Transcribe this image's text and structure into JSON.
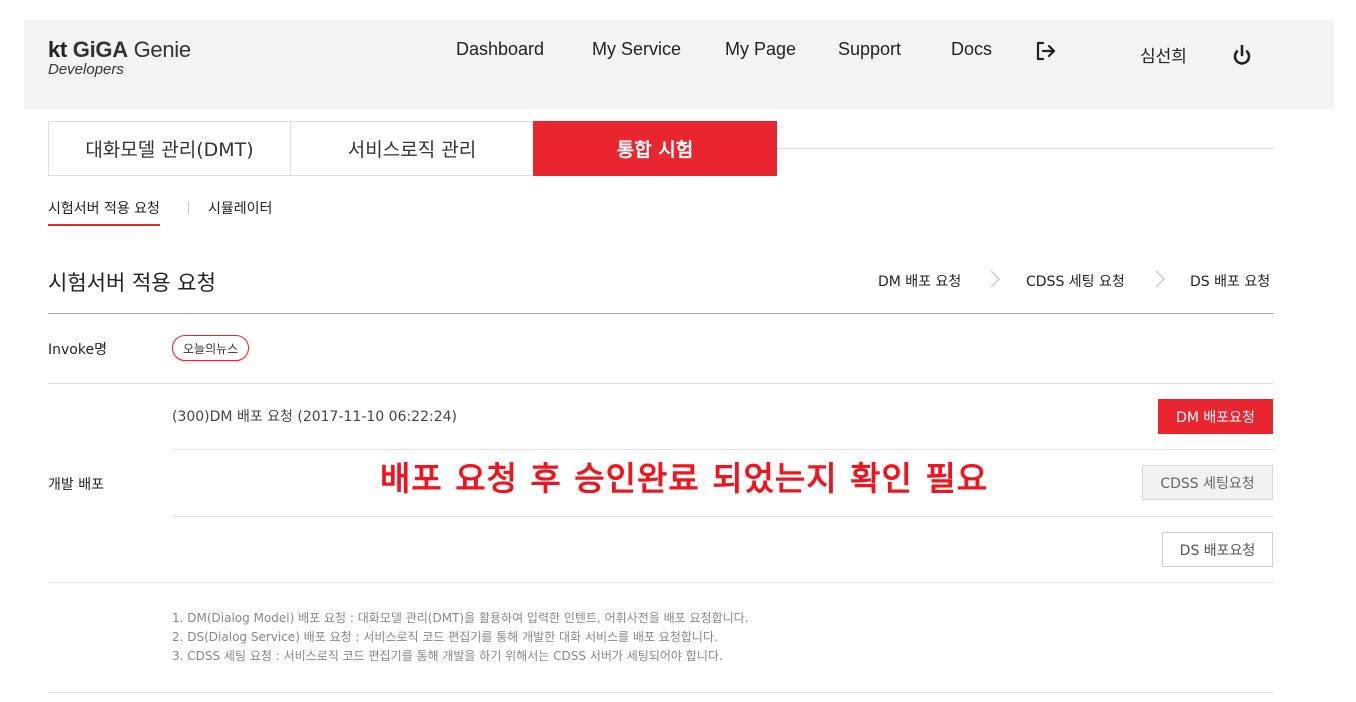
{
  "header": {
    "logo": {
      "kt": "kt",
      "giga": "GiGA",
      "genie": "Genie",
      "sub": "Developers"
    },
    "nav": [
      "Dashboard",
      "My Service",
      "My Page",
      "Support",
      "Docs"
    ],
    "user_name": "심선희",
    "icons": {
      "logout": "logout-icon",
      "power": "power-icon"
    }
  },
  "tabs": [
    {
      "label": "대화모델 관리(DMT)",
      "active": false
    },
    {
      "label": "서비스로직 관리",
      "active": false
    },
    {
      "label": "통합 시험",
      "active": true
    }
  ],
  "subnav": {
    "items": [
      "시험서버 적용 요청",
      "시뮬레이터"
    ],
    "active_index": 0
  },
  "section": {
    "title": "시험서버 적용 요청",
    "steps": [
      "DM 배포 요청",
      "CDSS 세팅 요청",
      "DS 배포 요청"
    ]
  },
  "invoke": {
    "label": "Invoke명",
    "value": "오늘의뉴스"
  },
  "deploy": {
    "label": "개발 배포",
    "status": "(300)DM 배포 요청 (2017-11-10 06:22:24)",
    "buttons": {
      "dm": "DM 배포요청",
      "cdss": "CDSS 세팅요청",
      "ds": "DS 배포요청"
    }
  },
  "annotation": "배포 요청 후 승인완료 되었는지 확인 필요",
  "notes": [
    "1. DM(Dialog Model) 배포 요청 : 대화모델 관리(DMT)을 활용하여 입력한 인텐트, 어휘사전을 배포 요청합니다.",
    "2. DS(Dialog Service) 배포 요청 : 서비스로직 코드 편집기를 통해 개발한 대화 서비스를 배포 요청합니다.",
    "3. CDSS 세팅 요청 : 서비스로직 코드 편집기를 통해 개발을 하기 위해서는 CDSS 서버가 세팅되어야 합니다."
  ],
  "colors": {
    "accent": "#e9262f",
    "annotation": "#f0141e",
    "header_bg": "#f4f4f4"
  }
}
